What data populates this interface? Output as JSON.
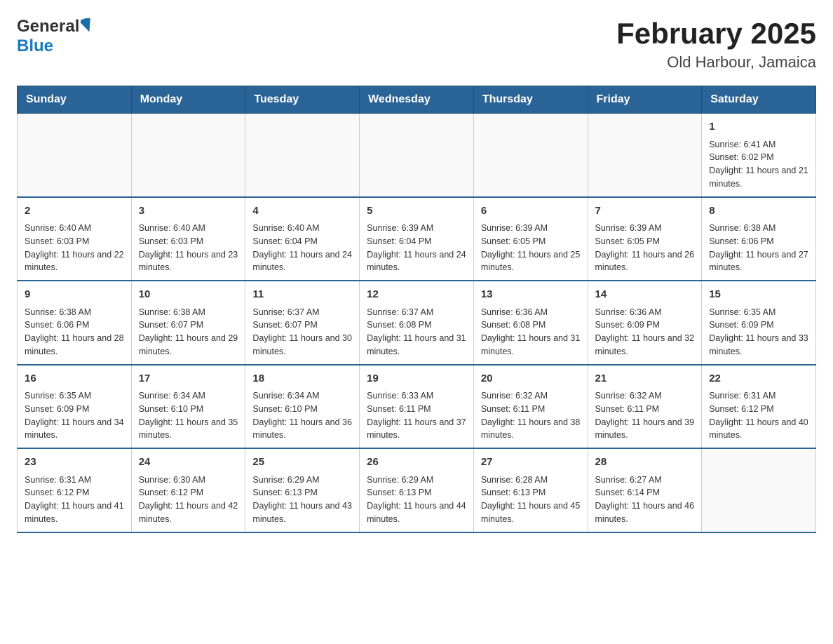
{
  "logo": {
    "general": "General",
    "blue": "Blue",
    "arrow": "▶"
  },
  "title": "February 2025",
  "subtitle": "Old Harbour, Jamaica",
  "weekdays": [
    "Sunday",
    "Monday",
    "Tuesday",
    "Wednesday",
    "Thursday",
    "Friday",
    "Saturday"
  ],
  "weeks": [
    [
      {
        "day": "",
        "sunrise": "",
        "sunset": "",
        "daylight": ""
      },
      {
        "day": "",
        "sunrise": "",
        "sunset": "",
        "daylight": ""
      },
      {
        "day": "",
        "sunrise": "",
        "sunset": "",
        "daylight": ""
      },
      {
        "day": "",
        "sunrise": "",
        "sunset": "",
        "daylight": ""
      },
      {
        "day": "",
        "sunrise": "",
        "sunset": "",
        "daylight": ""
      },
      {
        "day": "",
        "sunrise": "",
        "sunset": "",
        "daylight": ""
      },
      {
        "day": "1",
        "sunrise": "Sunrise: 6:41 AM",
        "sunset": "Sunset: 6:02 PM",
        "daylight": "Daylight: 11 hours and 21 minutes."
      }
    ],
    [
      {
        "day": "2",
        "sunrise": "Sunrise: 6:40 AM",
        "sunset": "Sunset: 6:03 PM",
        "daylight": "Daylight: 11 hours and 22 minutes."
      },
      {
        "day": "3",
        "sunrise": "Sunrise: 6:40 AM",
        "sunset": "Sunset: 6:03 PM",
        "daylight": "Daylight: 11 hours and 23 minutes."
      },
      {
        "day": "4",
        "sunrise": "Sunrise: 6:40 AM",
        "sunset": "Sunset: 6:04 PM",
        "daylight": "Daylight: 11 hours and 24 minutes."
      },
      {
        "day": "5",
        "sunrise": "Sunrise: 6:39 AM",
        "sunset": "Sunset: 6:04 PM",
        "daylight": "Daylight: 11 hours and 24 minutes."
      },
      {
        "day": "6",
        "sunrise": "Sunrise: 6:39 AM",
        "sunset": "Sunset: 6:05 PM",
        "daylight": "Daylight: 11 hours and 25 minutes."
      },
      {
        "day": "7",
        "sunrise": "Sunrise: 6:39 AM",
        "sunset": "Sunset: 6:05 PM",
        "daylight": "Daylight: 11 hours and 26 minutes."
      },
      {
        "day": "8",
        "sunrise": "Sunrise: 6:38 AM",
        "sunset": "Sunset: 6:06 PM",
        "daylight": "Daylight: 11 hours and 27 minutes."
      }
    ],
    [
      {
        "day": "9",
        "sunrise": "Sunrise: 6:38 AM",
        "sunset": "Sunset: 6:06 PM",
        "daylight": "Daylight: 11 hours and 28 minutes."
      },
      {
        "day": "10",
        "sunrise": "Sunrise: 6:38 AM",
        "sunset": "Sunset: 6:07 PM",
        "daylight": "Daylight: 11 hours and 29 minutes."
      },
      {
        "day": "11",
        "sunrise": "Sunrise: 6:37 AM",
        "sunset": "Sunset: 6:07 PM",
        "daylight": "Daylight: 11 hours and 30 minutes."
      },
      {
        "day": "12",
        "sunrise": "Sunrise: 6:37 AM",
        "sunset": "Sunset: 6:08 PM",
        "daylight": "Daylight: 11 hours and 31 minutes."
      },
      {
        "day": "13",
        "sunrise": "Sunrise: 6:36 AM",
        "sunset": "Sunset: 6:08 PM",
        "daylight": "Daylight: 11 hours and 31 minutes."
      },
      {
        "day": "14",
        "sunrise": "Sunrise: 6:36 AM",
        "sunset": "Sunset: 6:09 PM",
        "daylight": "Daylight: 11 hours and 32 minutes."
      },
      {
        "day": "15",
        "sunrise": "Sunrise: 6:35 AM",
        "sunset": "Sunset: 6:09 PM",
        "daylight": "Daylight: 11 hours and 33 minutes."
      }
    ],
    [
      {
        "day": "16",
        "sunrise": "Sunrise: 6:35 AM",
        "sunset": "Sunset: 6:09 PM",
        "daylight": "Daylight: 11 hours and 34 minutes."
      },
      {
        "day": "17",
        "sunrise": "Sunrise: 6:34 AM",
        "sunset": "Sunset: 6:10 PM",
        "daylight": "Daylight: 11 hours and 35 minutes."
      },
      {
        "day": "18",
        "sunrise": "Sunrise: 6:34 AM",
        "sunset": "Sunset: 6:10 PM",
        "daylight": "Daylight: 11 hours and 36 minutes."
      },
      {
        "day": "19",
        "sunrise": "Sunrise: 6:33 AM",
        "sunset": "Sunset: 6:11 PM",
        "daylight": "Daylight: 11 hours and 37 minutes."
      },
      {
        "day": "20",
        "sunrise": "Sunrise: 6:32 AM",
        "sunset": "Sunset: 6:11 PM",
        "daylight": "Daylight: 11 hours and 38 minutes."
      },
      {
        "day": "21",
        "sunrise": "Sunrise: 6:32 AM",
        "sunset": "Sunset: 6:11 PM",
        "daylight": "Daylight: 11 hours and 39 minutes."
      },
      {
        "day": "22",
        "sunrise": "Sunrise: 6:31 AM",
        "sunset": "Sunset: 6:12 PM",
        "daylight": "Daylight: 11 hours and 40 minutes."
      }
    ],
    [
      {
        "day": "23",
        "sunrise": "Sunrise: 6:31 AM",
        "sunset": "Sunset: 6:12 PM",
        "daylight": "Daylight: 11 hours and 41 minutes."
      },
      {
        "day": "24",
        "sunrise": "Sunrise: 6:30 AM",
        "sunset": "Sunset: 6:12 PM",
        "daylight": "Daylight: 11 hours and 42 minutes."
      },
      {
        "day": "25",
        "sunrise": "Sunrise: 6:29 AM",
        "sunset": "Sunset: 6:13 PM",
        "daylight": "Daylight: 11 hours and 43 minutes."
      },
      {
        "day": "26",
        "sunrise": "Sunrise: 6:29 AM",
        "sunset": "Sunset: 6:13 PM",
        "daylight": "Daylight: 11 hours and 44 minutes."
      },
      {
        "day": "27",
        "sunrise": "Sunrise: 6:28 AM",
        "sunset": "Sunset: 6:13 PM",
        "daylight": "Daylight: 11 hours and 45 minutes."
      },
      {
        "day": "28",
        "sunrise": "Sunrise: 6:27 AM",
        "sunset": "Sunset: 6:14 PM",
        "daylight": "Daylight: 11 hours and 46 minutes."
      },
      {
        "day": "",
        "sunrise": "",
        "sunset": "",
        "daylight": ""
      }
    ]
  ]
}
